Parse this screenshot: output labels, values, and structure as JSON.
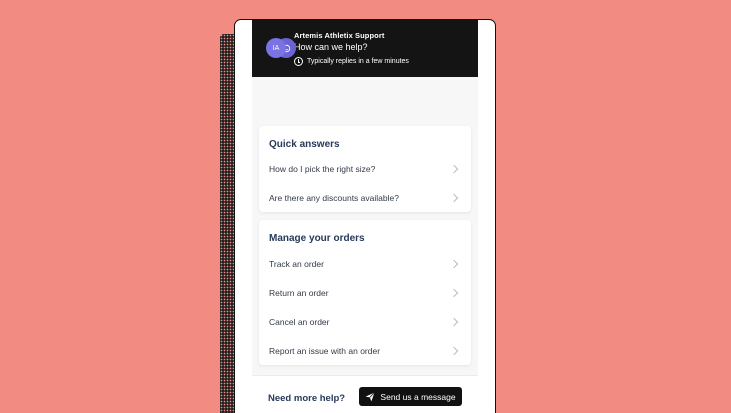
{
  "header": {
    "title": "Artemis Athletix Support",
    "subtitle": "How can we help?",
    "reply_time": "Typically replies in a few minutes",
    "avatar_initials": "IA"
  },
  "quick_answers": {
    "title": "Quick answers",
    "items": [
      {
        "label": "How do I pick the right size?"
      },
      {
        "label": "Are there any discounts available?"
      }
    ]
  },
  "orders": {
    "title": "Manage your orders",
    "items": [
      {
        "label": "Track an order"
      },
      {
        "label": "Return an order"
      },
      {
        "label": "Cancel an order"
      },
      {
        "label": "Report an issue with an order"
      }
    ]
  },
  "footer": {
    "prompt": "Need more help?",
    "button_label": "Send us a message"
  },
  "colors": {
    "background": "#f28b82",
    "header": "#141414",
    "avatar": "#7a73e6",
    "heading_text": "#263a5a"
  }
}
